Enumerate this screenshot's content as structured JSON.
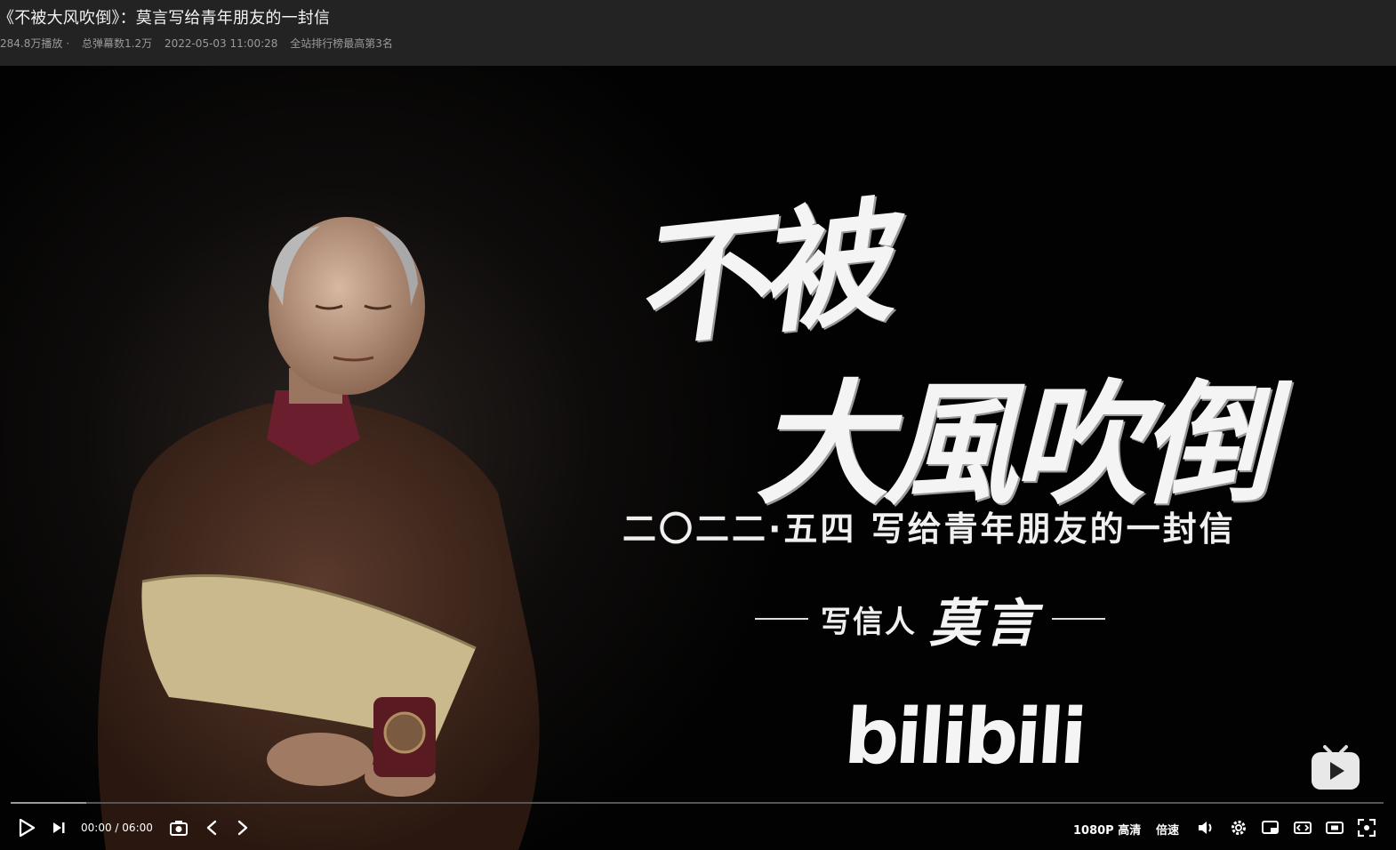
{
  "video": {
    "title": "《不被大风吹倒》：莫言写给青年朋友的一封信",
    "meta": {
      "plays": "284.8万播放",
      "separator": "·",
      "danmaku": "总弹幕数1.2万",
      "datetime": "2022-05-03 11:00:28",
      "rank": "全站排行榜最高第3名"
    }
  },
  "frame": {
    "calligraphy_line1": "不被",
    "calligraphy_line2": "大風吹倒",
    "subtitle": "二〇二二·五四 写给青年朋友的一封信",
    "writer_label": "写信人",
    "writer_name": "莫言",
    "logo_text": "bilibili"
  },
  "player": {
    "current_time": "00:00",
    "time_separator": "/",
    "duration": "06:00",
    "progress_fraction": 0.055,
    "quality": "1080P 高清",
    "speed": "倍速",
    "icons": [
      "play-icon",
      "next-icon",
      "screenshot-icon",
      "prev-frame-icon",
      "next-frame-icon",
      "volume-icon",
      "settings-icon",
      "pip-icon",
      "widescreen-icon",
      "web-fullscreen-icon",
      "fullscreen-icon"
    ]
  }
}
